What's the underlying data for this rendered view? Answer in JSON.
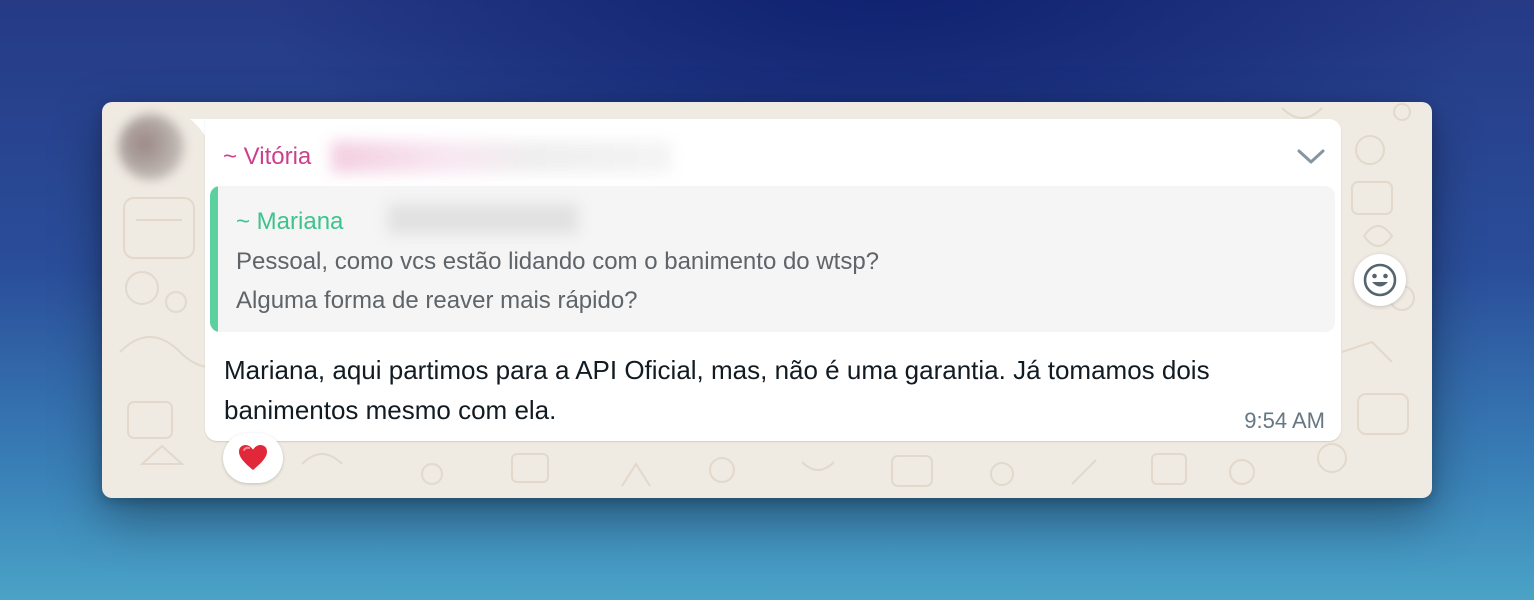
{
  "message": {
    "sender_name": "~ Vitória",
    "text": "Mariana, aqui partimos para a API Oficial, mas, não é uma garantia. Já tomamos dois banimentos mesmo com ela.",
    "time": "9:54 AM",
    "quoted": {
      "author": "~ Mariana",
      "lines": [
        "Pessoal, como vcs estão lidando com o banimento do wtsp?",
        "Alguma forma de reaver mais rápido?"
      ]
    },
    "reaction": {
      "emoji": "❤️"
    }
  },
  "icons": {
    "menu": "chevron-down-icon",
    "react": "smiley-icon"
  },
  "colors": {
    "sender": "#cc3f8d",
    "quote_author": "#3ec28e",
    "quote_bar": "#5dd0a0",
    "chat_background": "#efeae2",
    "bubble": "#ffffff"
  }
}
